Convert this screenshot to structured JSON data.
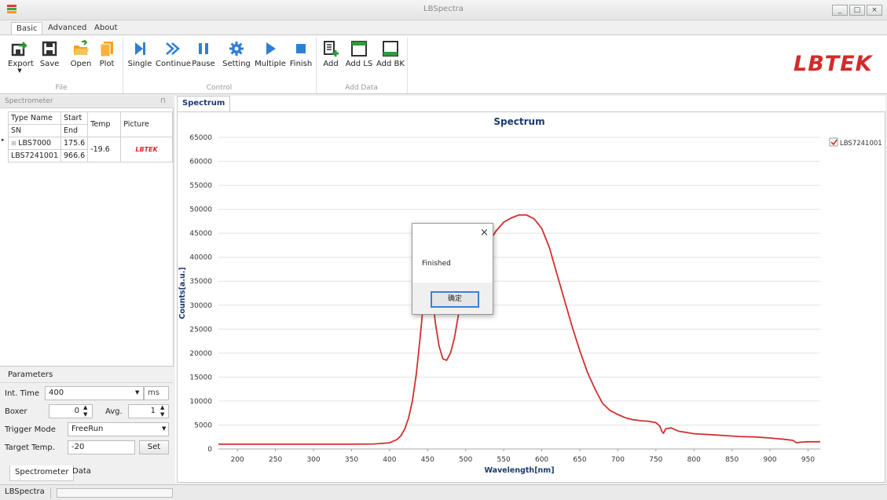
{
  "window": {
    "title": "LBSpectra"
  },
  "ribbon_tabs": [
    "Basic",
    "Advanced",
    "About"
  ],
  "ribbon": {
    "groups": [
      {
        "label": "File",
        "buttons": [
          "Export",
          "Save",
          "Open",
          "Plot"
        ]
      },
      {
        "label": "Control",
        "buttons": [
          "Single",
          "Continue",
          "Pause",
          "Setting",
          "Multiple",
          "Finish"
        ]
      },
      {
        "label": "Add Data",
        "buttons": [
          "Add",
          "Add LS",
          "Add BK"
        ]
      }
    ],
    "logo": "LBTEK"
  },
  "spectrometer": {
    "header": "Spectrometer",
    "columns": [
      "Type Name",
      "Start",
      "Temp",
      "Picture"
    ],
    "subcolumns": [
      "SN",
      "End"
    ],
    "rows": [
      {
        "type_name": "LBS7000",
        "sn": "LBS7241001",
        "start": "175.6",
        "end": "966.6",
        "temp": "-19.6",
        "picture": "LBTEK"
      }
    ]
  },
  "parameters": {
    "header": "Parameters",
    "int_time_label": "Int. Time",
    "int_time_value": "400",
    "int_time_unit": "ms",
    "boxer_label": "Boxer",
    "boxer_value": "0",
    "avg_label": "Avg.",
    "avg_value": "1",
    "trigger_label": "Trigger Mode",
    "trigger_value": "FreeRun",
    "target_label": "Target Temp.",
    "target_value": "-20",
    "set_label": "Set"
  },
  "left_tabs": [
    "Spectrometer",
    "Data"
  ],
  "main_tab": "Spectrum",
  "status": {
    "app": "LBSpectra"
  },
  "dialog": {
    "message": "Finished",
    "ok": "确定"
  },
  "colors": {
    "series": "#d0302f",
    "logo": "#d42a2a",
    "title": "#1c3a6e"
  },
  "chart_data": {
    "type": "line",
    "title": "Spectrum",
    "xlabel": "Wavelength[nm]",
    "ylabel": "Counts[a.u.]",
    "xlim": [
      175,
      966
    ],
    "ylim": [
      0,
      65000
    ],
    "xticks": [
      200,
      250,
      300,
      350,
      400,
      450,
      500,
      550,
      600,
      650,
      700,
      750,
      800,
      850,
      900,
      950
    ],
    "yticks": [
      0,
      5000,
      10000,
      15000,
      20000,
      25000,
      30000,
      35000,
      40000,
      45000,
      50000,
      55000,
      60000,
      65000
    ],
    "legend": "top-right",
    "grid": true,
    "series": [
      {
        "name": "LBS7241001",
        "x": [
          175,
          200,
          250,
          300,
          350,
          380,
          400,
          410,
          415,
          420,
          425,
          430,
          435,
          440,
          445,
          450,
          455,
          460,
          465,
          470,
          475,
          480,
          485,
          490,
          495,
          500,
          505,
          510,
          515,
          520,
          530,
          540,
          550,
          560,
          570,
          580,
          590,
          600,
          610,
          620,
          630,
          640,
          650,
          660,
          670,
          680,
          690,
          700,
          710,
          720,
          730,
          740,
          750,
          755,
          758,
          760,
          763,
          770,
          780,
          800,
          820,
          840,
          860,
          880,
          900,
          920,
          930,
          935,
          940,
          950,
          966
        ],
        "y": [
          1000,
          1000,
          1000,
          1000,
          1000,
          1050,
          1300,
          2000,
          2800,
          4200,
          6500,
          10000,
          15500,
          23000,
          31500,
          36500,
          33500,
          26500,
          21500,
          18800,
          18500,
          20000,
          23000,
          27500,
          33000,
          38500,
          41500,
          42500,
          42200,
          41500,
          43000,
          45500,
          47300,
          48200,
          48800,
          48800,
          48000,
          46000,
          42000,
          36500,
          31000,
          25500,
          20500,
          16000,
          12500,
          9500,
          8000,
          7200,
          6500,
          6100,
          5900,
          5800,
          5500,
          4800,
          3600,
          3300,
          4200,
          4400,
          3700,
          3200,
          3000,
          2800,
          2600,
          2500,
          2300,
          2000,
          1800,
          1300,
          1400,
          1500,
          1500
        ]
      }
    ]
  }
}
